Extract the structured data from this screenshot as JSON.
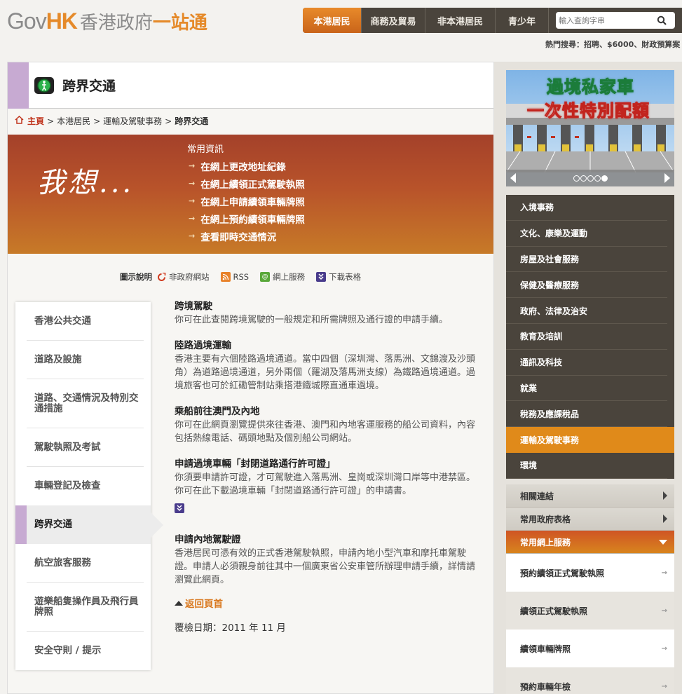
{
  "header": {
    "logo_gov": "Gov",
    "logo_hk": "HK",
    "logo_zh1": "香港政府",
    "logo_zh2": "一站通",
    "tabs": [
      "本港居民",
      "商務及貿易",
      "非本港居民",
      "青少年"
    ],
    "search_placeholder": "輸入查詢字串",
    "hot_search": "熱門搜尋：招聘、$6000、財政預算案"
  },
  "page": {
    "title": "跨界交通",
    "breadcrumb": [
      "主頁",
      "本港居民",
      "運輸及駕駛事務",
      "跨界交通"
    ]
  },
  "banner": {
    "iwant": "我想...",
    "freq_title": "常用資訊",
    "links": [
      "在網上更改地址紀錄",
      "在網上續領正式駕駛執照",
      "在網上申請續領車輛牌照",
      "在網上預約續領車輛牌照",
      "查看即時交通情況"
    ]
  },
  "legend": {
    "label": "圖示說明",
    "items": [
      "非政府網站",
      "RSS",
      "網上服務",
      "下載表格"
    ]
  },
  "subnav": [
    "香港公共交通",
    "道路及設施",
    "道路、交通情況及特別交通措施",
    "駕駛執照及考試",
    "車輛登記及檢查",
    "跨界交通",
    "航空旅客服務",
    "遊樂船隻操作員及飛行員牌照",
    "安全守則 / 提示"
  ],
  "sections": [
    {
      "title": "跨境駕駛",
      "body": "你可在此查閱跨境駕駛的一般規定和所需牌照及通行證的申請手續。"
    },
    {
      "title": "陸路過境運輸",
      "body": "香港主要有六個陸路過境通道。當中四個（深圳灣、落馬洲、文錦渡及沙頭角）為道路過境通道，另外兩個（羅湖及落馬洲支線）為鐵路過境通道。過境旅客也可於紅磡管制站乘搭港鐵城際直通車過境。"
    },
    {
      "title": "乘船前往澳門及內地",
      "body": "你可在此網頁瀏覽提供來往香港、澳門和內地客運服務的船公司資料，內容包括熱線電話、碼頭地點及個別船公司網站。"
    },
    {
      "title": "申請過境車輛「封閉道路通行許可證」",
      "body": "你須要申請許可證，才可駕駛進入落馬洲、皇崗或深圳灣口岸等中港禁區。你可在此下載過境車輛「封閉道路通行許可證」的申請書。"
    },
    {
      "title": "申請內地駕駛證",
      "body": "香港居民可憑有效的正式香港駕駛執照，申請內地小型汽車和摩托車駕駛證。申請人必須親身前往其中一個廣東省公安車管所辦理申請手續，詳情請瀏覽此網頁。"
    }
  ],
  "back_to_top": "返回頁首",
  "review_date": "覆檢日期：2011 年 11 月",
  "slider": {
    "caption1": "過境私家車",
    "caption2": "一次性特別配額"
  },
  "topics": [
    "入境事務",
    "文化、康樂及運動",
    "房屋及社會服務",
    "保健及醫療服務",
    "政府、法律及治安",
    "教育及培訓",
    "通訊及科技",
    "就業",
    "稅務及應課稅品",
    "運輸及駕駛事務",
    "環境"
  ],
  "related": {
    "headers": [
      "相關連結",
      "常用政府表格",
      "常用網上服務"
    ],
    "services": [
      "預約續領正式駕駛執照",
      "續領正式駕駛執照",
      "續領車輛牌照",
      "預約車輛年檢"
    ]
  },
  "colors": {
    "accent_orange": "#e08a1a",
    "nav_dark": "#4a443c",
    "banner_red": "#a4412a",
    "page_purple": "#c7aad2"
  }
}
